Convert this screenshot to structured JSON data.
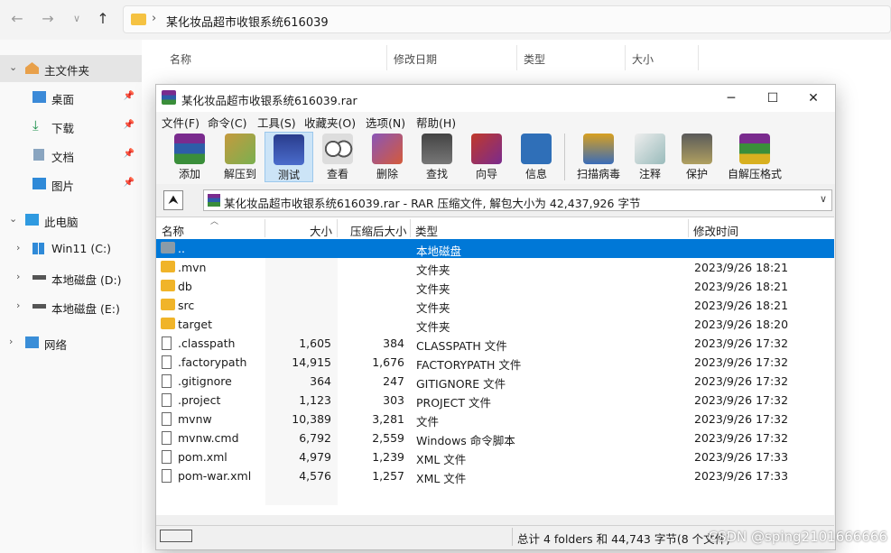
{
  "explorer": {
    "address": "某化妆品超市收银系统616039",
    "columns": [
      "名称",
      "修改日期",
      "类型",
      "大小"
    ],
    "sidebar": [
      {
        "label": "主文件夹",
        "icon": "home-icon"
      },
      {
        "label": "桌面",
        "icon": "desktop-icon"
      },
      {
        "label": "下载",
        "icon": "download-icon"
      },
      {
        "label": "文档",
        "icon": "document-icon"
      },
      {
        "label": "图片",
        "icon": "picture-icon"
      },
      {
        "label": "此电脑",
        "icon": "computer-icon"
      },
      {
        "label": "Win11 (C:)",
        "icon": "drive-windows-icon"
      },
      {
        "label": "本地磁盘 (D:)",
        "icon": "drive-icon"
      },
      {
        "label": "本地磁盘 (E:)",
        "icon": "drive-icon"
      },
      {
        "label": "网络",
        "icon": "network-icon"
      }
    ]
  },
  "rar": {
    "title": "某化妆品超市收银系统616039.rar",
    "menu": [
      "文件(F)",
      "命令(C)",
      "工具(S)",
      "收藏夹(O)",
      "选项(N)",
      "帮助(H)"
    ],
    "toolbar": [
      "添加",
      "解压到",
      "测试",
      "查看",
      "删除",
      "查找",
      "向导",
      "信息",
      "扫描病毒",
      "注释",
      "保护",
      "自解压格式"
    ],
    "path": "某化妆品超市收银系统616039.rar - RAR 压缩文件, 解包大小为 42,437,926 字节",
    "columns": [
      "名称",
      "大小",
      "压缩后大小",
      "类型",
      "修改时间"
    ],
    "rows": [
      {
        "name": "..",
        "size": "",
        "packed": "",
        "type": "本地磁盘",
        "date": "",
        "kind": "up"
      },
      {
        "name": ".mvn",
        "size": "",
        "packed": "",
        "type": "文件夹",
        "date": "2023/9/26 18:21",
        "kind": "folder"
      },
      {
        "name": "db",
        "size": "",
        "packed": "",
        "type": "文件夹",
        "date": "2023/9/26 18:21",
        "kind": "folder"
      },
      {
        "name": "src",
        "size": "",
        "packed": "",
        "type": "文件夹",
        "date": "2023/9/26 18:21",
        "kind": "folder"
      },
      {
        "name": "target",
        "size": "",
        "packed": "",
        "type": "文件夹",
        "date": "2023/9/26 18:20",
        "kind": "folder"
      },
      {
        "name": ".classpath",
        "size": "1,605",
        "packed": "384",
        "type": "CLASSPATH 文件",
        "date": "2023/9/26 17:32",
        "kind": "file"
      },
      {
        "name": ".factorypath",
        "size": "14,915",
        "packed": "1,676",
        "type": "FACTORYPATH 文件",
        "date": "2023/9/26 17:32",
        "kind": "file"
      },
      {
        "name": ".gitignore",
        "size": "364",
        "packed": "247",
        "type": "GITIGNORE 文件",
        "date": "2023/9/26 17:32",
        "kind": "file"
      },
      {
        "name": ".project",
        "size": "1,123",
        "packed": "303",
        "type": "PROJECT 文件",
        "date": "2023/9/26 17:32",
        "kind": "file"
      },
      {
        "name": "mvnw",
        "size": "10,389",
        "packed": "3,281",
        "type": "文件",
        "date": "2023/9/26 17:32",
        "kind": "file"
      },
      {
        "name": "mvnw.cmd",
        "size": "6,792",
        "packed": "2,559",
        "type": "Windows 命令脚本",
        "date": "2023/9/26 17:32",
        "kind": "file"
      },
      {
        "name": "pom.xml",
        "size": "4,979",
        "packed": "1,239",
        "type": "XML 文件",
        "date": "2023/9/26 17:33",
        "kind": "file"
      },
      {
        "name": "pom-war.xml",
        "size": "4,576",
        "packed": "1,257",
        "type": "XML 文件",
        "date": "2023/9/26 17:33",
        "kind": "file"
      }
    ],
    "status": "总计 4 folders 和 44,743 字节(8 个文件)"
  },
  "watermark": "CSDN @sping2101666666"
}
